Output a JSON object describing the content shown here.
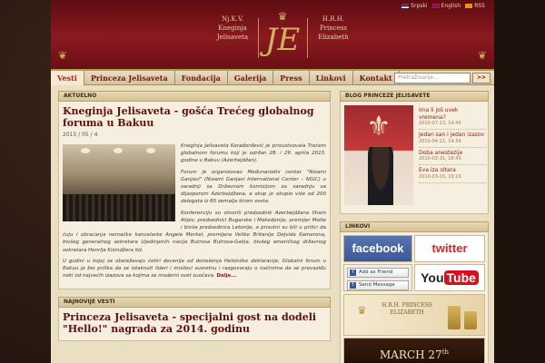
{
  "topbar": {
    "lang_sr": "Srpski",
    "lang_en": "English",
    "rss": "RSS"
  },
  "logo": {
    "left_lines": [
      "Nj.K.V.",
      "Kneginja",
      "Jelisaveta"
    ],
    "right_lines": [
      "H.R.H.",
      "Princess",
      "Elizabeth"
    ],
    "monogram": "JE",
    "crown_icon": "♛"
  },
  "nav": {
    "items": [
      "Vesti",
      "Princeza Jelisaveta",
      "Fondacija",
      "Galerija",
      "Press",
      "Linkovi",
      "Kontakt"
    ],
    "active_index": 0,
    "search_placeholder": "Pretraživanje...",
    "search_button": ">>"
  },
  "aktuelno": {
    "heading": "AKTUELNO",
    "title": "Kneginja Jelisaveta - gošća Trećeg globalnog foruma u Bakuu",
    "date": "2015 / 05 / 4",
    "p1": "Kneginja Jelisaveta Karađorđević je prisustvovala Trećem globalnom forumu koji je održan 28. i 29. aprila 2015. godine u Bakuu (Azerbejdžan).",
    "p2": "Forum je organizovao Međunarodni centar \"Nizami Ganjavi\" (Nizami Ganjavi International Center – NGIC) u saradnji sa Državnom komisijom za saradnju sa dijasporom Azerbejdžana, a skup je okupio više od 200 delegata iz 60 zemalja širom sveta.",
    "p3": "Konferenciju su otvorili predsednik Azerbejdžana Ilham Alijev, predsednici Bugarske i Makedonije, premijer Malte i bivša predsednica Letonije, a prisutni su bili u prilici da čuju i obraćanja nemačke kancelarke Angele Merkel, premijera Velike Britanije Dejvida Kamerona, bivšeg generalnog sekretara Ujedinjenih nacija Butrosa Butrosa-Galija, bivšeg američkog državnog sekretara Henrija Kisindžera itd.",
    "p4": "U godini u kojoj se obeležavaju četiri decenije od donošenja Helsinške deklaracije, Globalni forum u Bakuu je bio prilika da se istaknuti lideri i mislioci susretnu i razgovaraju o načinima da se prevaziđu neki od najvećih izazova sa kojima se moderni svet suočava.",
    "more": "Dalje..."
  },
  "najnovije": {
    "heading": "NAJNOVIJE VESTI",
    "title": "Princeza Jelisaveta - specijalni gost na dodeli \"Hello!\" nagrada za 2014. godinu"
  },
  "blog": {
    "heading": "BLOG PRINCEZE JELISAVETE",
    "items": [
      {
        "title": "Ima li još uvek vremena?",
        "date": "2010-07-13, 14:40"
      },
      {
        "title": "Jedan san i jedan izazov",
        "date": "2010-04-11, 14:34"
      },
      {
        "title": "Doba anestezije",
        "date": "2010-03-31, 18:40"
      },
      {
        "title": "Eva iza oltara",
        "date": "2010-03-15, 19:19"
      }
    ]
  },
  "linkovi": {
    "heading": "LINKOVI",
    "facebook": "facebook",
    "twitter": "twitter",
    "add_friend": "Add as Friend",
    "send_message": "Send Message",
    "youtube_you": "You",
    "youtube_tube": "Tube",
    "perfume": "H.R.H. PRINCESS ELIZABETH",
    "march": "MARCH 27",
    "march_sup": "th"
  }
}
